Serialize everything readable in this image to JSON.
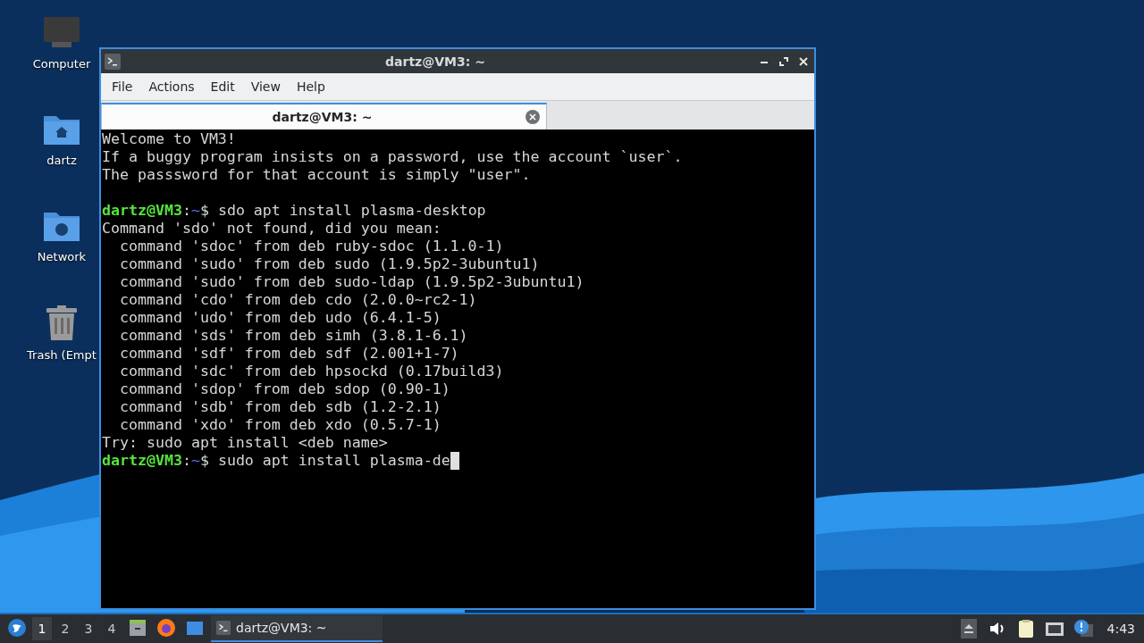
{
  "desktop_icons": [
    {
      "label": "Computer",
      "kind": "computer"
    },
    {
      "label": "dartz",
      "kind": "home"
    },
    {
      "label": "Network",
      "kind": "network"
    },
    {
      "label": "Trash (Empt",
      "kind": "trash"
    }
  ],
  "window": {
    "title": "dartz@VM3: ~",
    "menu": [
      "File",
      "Actions",
      "Edit",
      "View",
      "Help"
    ],
    "tabs": [
      {
        "label": "dartz@VM3: ~",
        "selected": true
      }
    ],
    "terminal": {
      "lines": [
        {
          "kind": "output",
          "text": "Welcome to VM3!"
        },
        {
          "kind": "output",
          "text": "If a buggy program insists on a password, use the account `user`."
        },
        {
          "kind": "output",
          "text": "The passsword for that account is simply \"user\"."
        },
        {
          "kind": "blank"
        },
        {
          "kind": "prompt",
          "user": "dartz@VM3",
          "colon": ":",
          "path": "~",
          "text": "$ sdo apt install plasma-desktop",
          "cursor": false
        },
        {
          "kind": "output",
          "text": "Command 'sdo' not found, did you mean:"
        },
        {
          "kind": "output",
          "text": "  command 'sdoc' from deb ruby-sdoc (1.1.0-1)"
        },
        {
          "kind": "output",
          "text": "  command 'sudo' from deb sudo (1.9.5p2-3ubuntu1)"
        },
        {
          "kind": "output",
          "text": "  command 'sudo' from deb sudo-ldap (1.9.5p2-3ubuntu1)"
        },
        {
          "kind": "output",
          "text": "  command 'cdo' from deb cdo (2.0.0~rc2-1)"
        },
        {
          "kind": "output",
          "text": "  command 'udo' from deb udo (6.4.1-5)"
        },
        {
          "kind": "output",
          "text": "  command 'sds' from deb simh (3.8.1-6.1)"
        },
        {
          "kind": "output",
          "text": "  command 'sdf' from deb sdf (2.001+1-7)"
        },
        {
          "kind": "output",
          "text": "  command 'sdc' from deb hpsockd (0.17build3)"
        },
        {
          "kind": "output",
          "text": "  command 'sdop' from deb sdop (0.90-1)"
        },
        {
          "kind": "output",
          "text": "  command 'sdb' from deb sdb (1.2-2.1)"
        },
        {
          "kind": "output",
          "text": "  command 'xdo' from deb xdo (0.5.7-1)"
        },
        {
          "kind": "output",
          "text": "Try: sudo apt install <deb name>"
        },
        {
          "kind": "prompt",
          "user": "dartz@VM3",
          "colon": ":",
          "path": "~",
          "text": "$ sudo apt install plasma-de",
          "cursor": true
        }
      ]
    }
  },
  "taskbar": {
    "workspaces": [
      {
        "label": "1",
        "selected": true
      },
      {
        "label": "2",
        "selected": false
      },
      {
        "label": "3",
        "selected": false
      },
      {
        "label": "4",
        "selected": false
      }
    ],
    "tasks": [
      {
        "label": "dartz@VM3: ~",
        "selected": true
      }
    ],
    "clock": "4:43"
  }
}
